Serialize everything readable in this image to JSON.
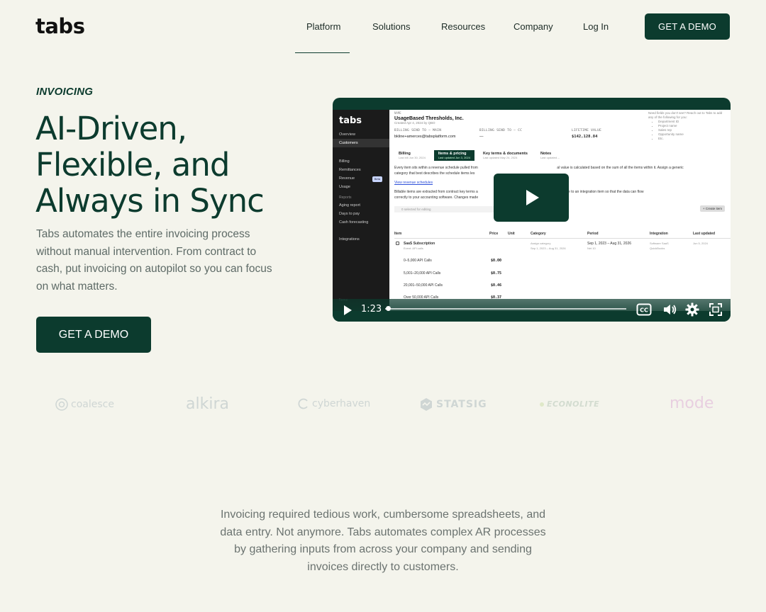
{
  "header": {
    "logo": "tabs",
    "nav": [
      "Platform",
      "Solutions",
      "Resources",
      "Company",
      "Log In"
    ],
    "cta": "GET A DEMO"
  },
  "hero": {
    "eyebrow": "INVOICING",
    "headline_lines": [
      "AI-Driven,",
      "Flexible, and",
      "Always in Sync"
    ],
    "subtext": "Tabs automates the entire invoicing process without manual intervention. From contract to cash, put invoicing on autopilot so you can focus on what matters.",
    "cta": "GET A DEMO"
  },
  "video": {
    "time": "1:23",
    "progress": 0.01,
    "controls": [
      "play-icon",
      "closed-captions-icon",
      "volume-icon",
      "settings-icon",
      "fullscreen-icon"
    ],
    "app": {
      "logo": "tabs",
      "sidebar": {
        "top": [
          "Overview",
          "Customers"
        ],
        "billing": [
          "Billing",
          "Remittances",
          "Revenue",
          "Usage"
        ],
        "beta": "Beta",
        "reports_label": "Reports",
        "reports": [
          "Aging report",
          "Days to pay",
          "Cash forecasting"
        ],
        "integrations": "Integrations",
        "bottom": "Items"
      },
      "small_label": "NAME",
      "company": "UsageBased Thresholds, Inc.",
      "created": "Created Apr 4, 2024 by QBO",
      "fields": [
        {
          "label": "BILLING SEND TO — MAIN",
          "value": "bkline+amerces@tabsplatform.com"
        },
        {
          "label": "BILLING SEND TO — CC",
          "value": "—"
        },
        {
          "label": "LIFETIME VALUE",
          "value": "$142,128.84"
        }
      ],
      "tabs": [
        {
          "title": "Billing",
          "sub": "Last bill Jun 30, 2024"
        },
        {
          "title": "Items & pricing",
          "sub": "Last updated Jun 3, 2024"
        },
        {
          "title": "Key terms & documents",
          "sub": "Last updated May 24, 2024"
        },
        {
          "title": "Notes",
          "sub": "Last updated --"
        }
      ],
      "para1_a": "Every item sits within a revenue schedule pulled from",
      "para1_b": "al value is calculated based on the sum of all the items within it. Assign a generic",
      "para1_c": "category that best describes the schedule items les",
      "link": "View revenue schedules",
      "para2_a": "Billable items are extracted from contract key terms a",
      "para2_b": "ust relate to an integration item so that the data can flow",
      "para2_c": "correctly to your accounting software. Changes made",
      "create_item": "+ Create item",
      "selected": "0 selected for editing",
      "table_headers": [
        "Item",
        "Price",
        "Unit",
        "Category",
        "Period",
        "Integration",
        "Last updated"
      ],
      "row": {
        "item": "SaaS Subscription",
        "item_sub": "Event: API calls",
        "category": "Assign category",
        "category_sub": "Sep 1, 2023 – Aug 31, 2026",
        "period": "Sep 1, 2023 – Aug 31, 2026",
        "period_sub": "Net 10",
        "integration": "Software SaaS",
        "integration_sub": "QuickBooks",
        "updated": "Jun 5, 2024"
      },
      "tiers": [
        {
          "label": "0–5,000 API Calls",
          "price": "$0.00"
        },
        {
          "label": "5,001–20,000 API Calls",
          "price": "$0.75"
        },
        {
          "label": "20,001–50,000 API Calls",
          "price": "$0.46"
        },
        {
          "label": "Over 50,000 API Calls",
          "price": "$0.37"
        }
      ],
      "tooltip": {
        "intro": "Need fields you don't see? Reach out to Tabs to add any of the following for you:",
        "items": [
          "Department ID",
          "Project name",
          "Sales rep",
          "Opportunity name",
          "Etc."
        ]
      }
    }
  },
  "logos": [
    "coalesce",
    "alkira",
    "cyberhaven",
    "STATSIG",
    "ECONOLITE",
    "mode"
  ],
  "bottom": {
    "text": "Invoicing required tedious work, cumbersome spreadsheets, and data entry. Not anymore. Tabs automates complex AR processes by gathering inputs from across your company and sending invoices directly to customers."
  },
  "colors": {
    "background": "#f4f4ec",
    "primary": "#0c3b2e",
    "muted_text": "#5e6b67",
    "logo_gray": "#cfd6d4"
  }
}
